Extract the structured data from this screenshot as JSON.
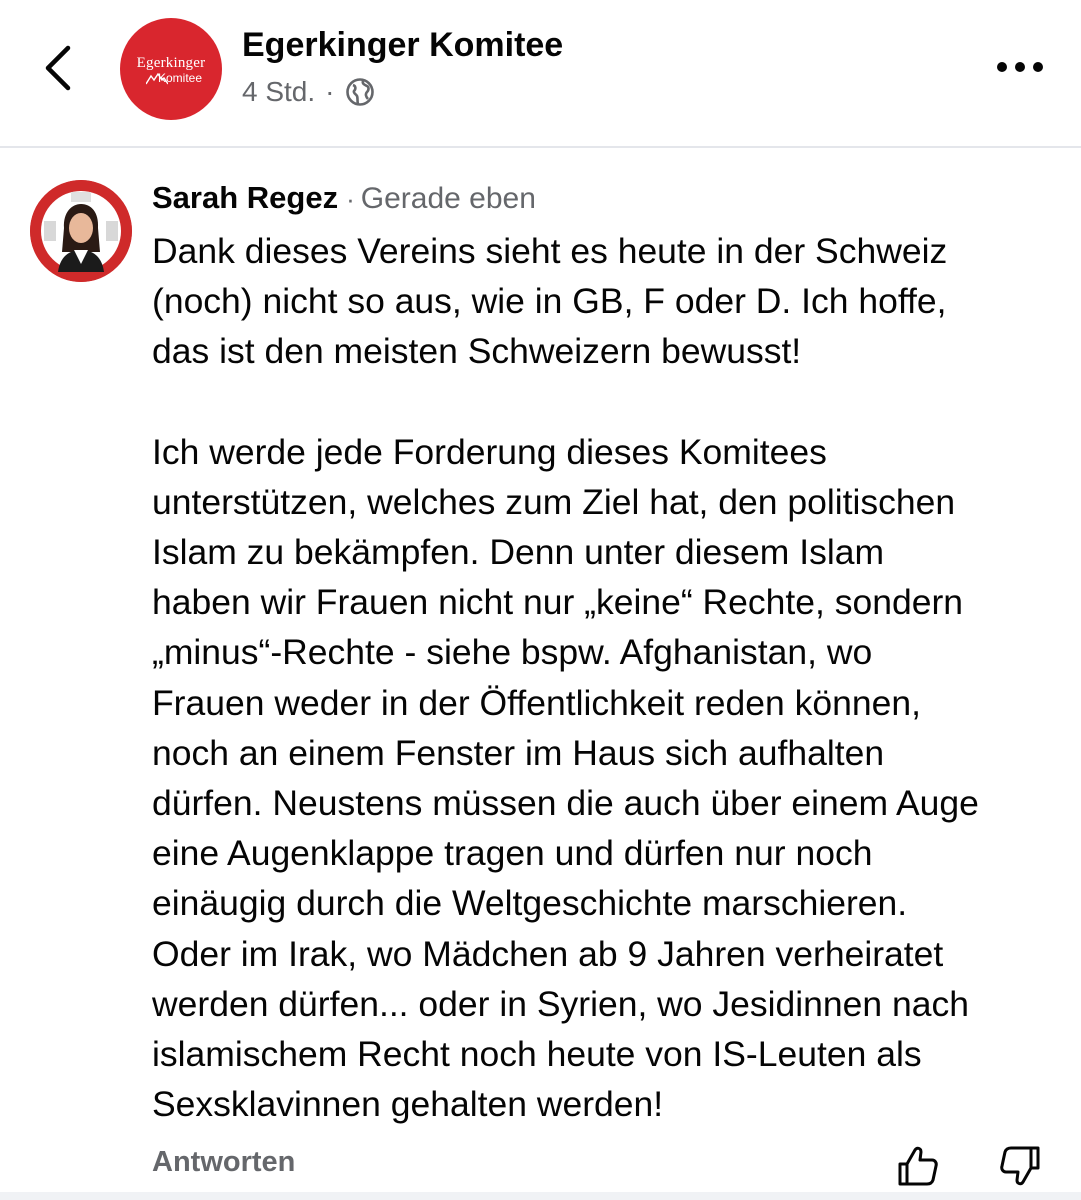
{
  "header": {
    "page_name": "Egerkinger Komitee",
    "time": "4 Std.",
    "separator": "·",
    "logo_line1": "Egerkinger",
    "logo_line2": "Komitee"
  },
  "comment": {
    "author": "Sarah Regez",
    "separator": "·",
    "time": "Gerade eben",
    "paragraph1": "Dank dieses Vereins sieht es heute in der Schweiz\n(noch) nicht so aus, wie in GB, F oder D. Ich hoffe,\ndas ist den meisten Schweizern bewusst!",
    "paragraph2": "Ich werde jede Forderung dieses Komitees\nunterstützen, welches zum Ziel hat, den politischen\nIslam zu bekämpfen. Denn unter diesem Islam\nhaben wir Frauen nicht nur „keine“ Rechte, sondern\n„minus“-Rechte - siehe bspw. Afghanistan, wo\nFrauen weder in der Öffentlichkeit reden können,\nnoch an einem Fenster im Haus sich aufhalten\ndürfen. Neustens müssen die auch über einem Auge\neine Augenklappe tragen und dürfen nur noch\neinäugig durch die Weltgeschichte marschieren.\nOder im Irak, wo Mädchen ab 9 Jahren verheiratet\nwerden dürfen... oder in Syrien, wo Jesidinnen nach\nislamischem Recht noch heute von IS-Leuten als\nSexsklavinnen gehalten werden!",
    "reply_label": "Antworten"
  },
  "icons": {
    "back": "chevron-left-icon",
    "globe": "globe-icon",
    "more": "more-dots-icon",
    "like": "thumbs-up-icon",
    "dislike": "thumbs-down-icon"
  },
  "colors": {
    "brand_red": "#d9262e",
    "secondary_text": "#65676b",
    "primary_text": "#050505"
  }
}
